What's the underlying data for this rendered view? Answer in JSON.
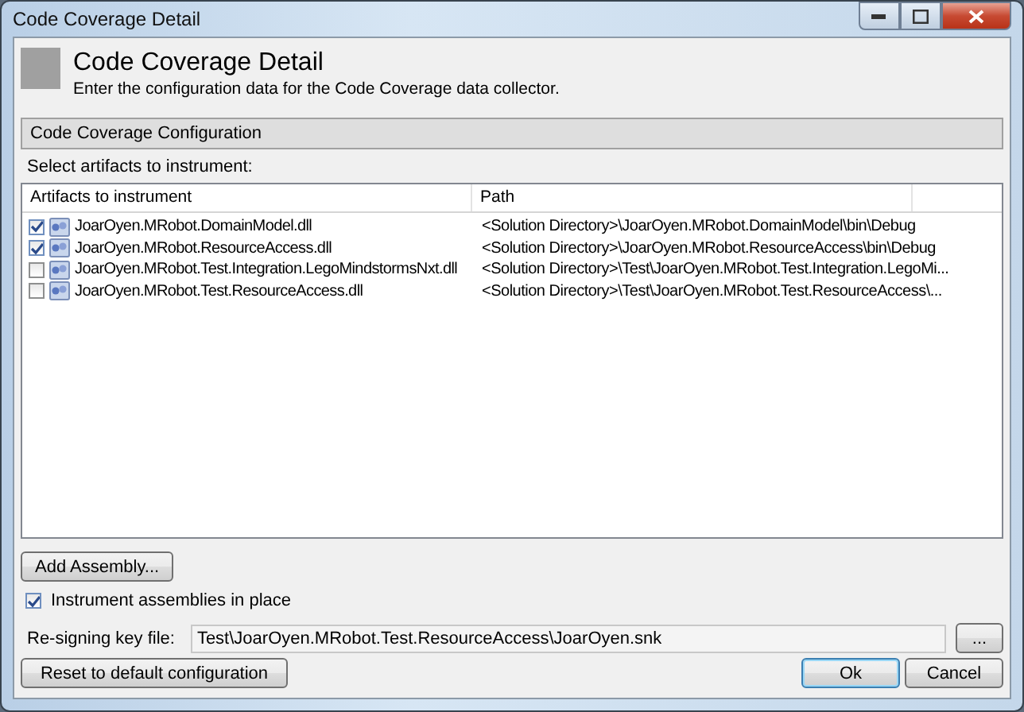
{
  "window": {
    "title": "Code Coverage Detail"
  },
  "header": {
    "title": "Code Coverage Detail",
    "subtitle": "Enter the configuration data for the Code Coverage data collector."
  },
  "section": {
    "title": "Code Coverage Configuration"
  },
  "artifacts_label": "Select artifacts to instrument:",
  "table": {
    "columns": [
      "Artifacts to instrument",
      "Path"
    ],
    "rows": [
      {
        "name": "JoarOyen.MRobot.DomainModel.dll",
        "path": "<Solution Directory>\\JoarOyen.MRobot.DomainModel\\bin\\Debug",
        "checked": true
      },
      {
        "name": "JoarOyen.MRobot.ResourceAccess.dll",
        "path": "<Solution Directory>\\JoarOyen.MRobot.ResourceAccess\\bin\\Debug",
        "checked": true
      },
      {
        "name": "JoarOyen.MRobot.Test.Integration.LegoMindstormsNxt.dll",
        "path": "<Solution Directory>\\Test\\JoarOyen.MRobot.Test.Integration.LegoMi...",
        "checked": false
      },
      {
        "name": "JoarOyen.MRobot.Test.ResourceAccess.dll",
        "path": "<Solution Directory>\\Test\\JoarOyen.MRobot.Test.ResourceAccess\\...",
        "checked": false
      }
    ]
  },
  "add_button": "Add Assembly...",
  "instrument_in_place": {
    "label": "Instrument assemblies in place",
    "checked": true
  },
  "key_file": {
    "label": "Re-signing key file:",
    "value": "Test\\JoarOyen.MRobot.Test.ResourceAccess\\JoarOyen.snk",
    "browse": "..."
  },
  "reset_button": "Reset to default configuration",
  "buttons": [
    {
      "label": "Ok",
      "default": true
    },
    {
      "label": "Cancel",
      "default": false
    }
  ]
}
